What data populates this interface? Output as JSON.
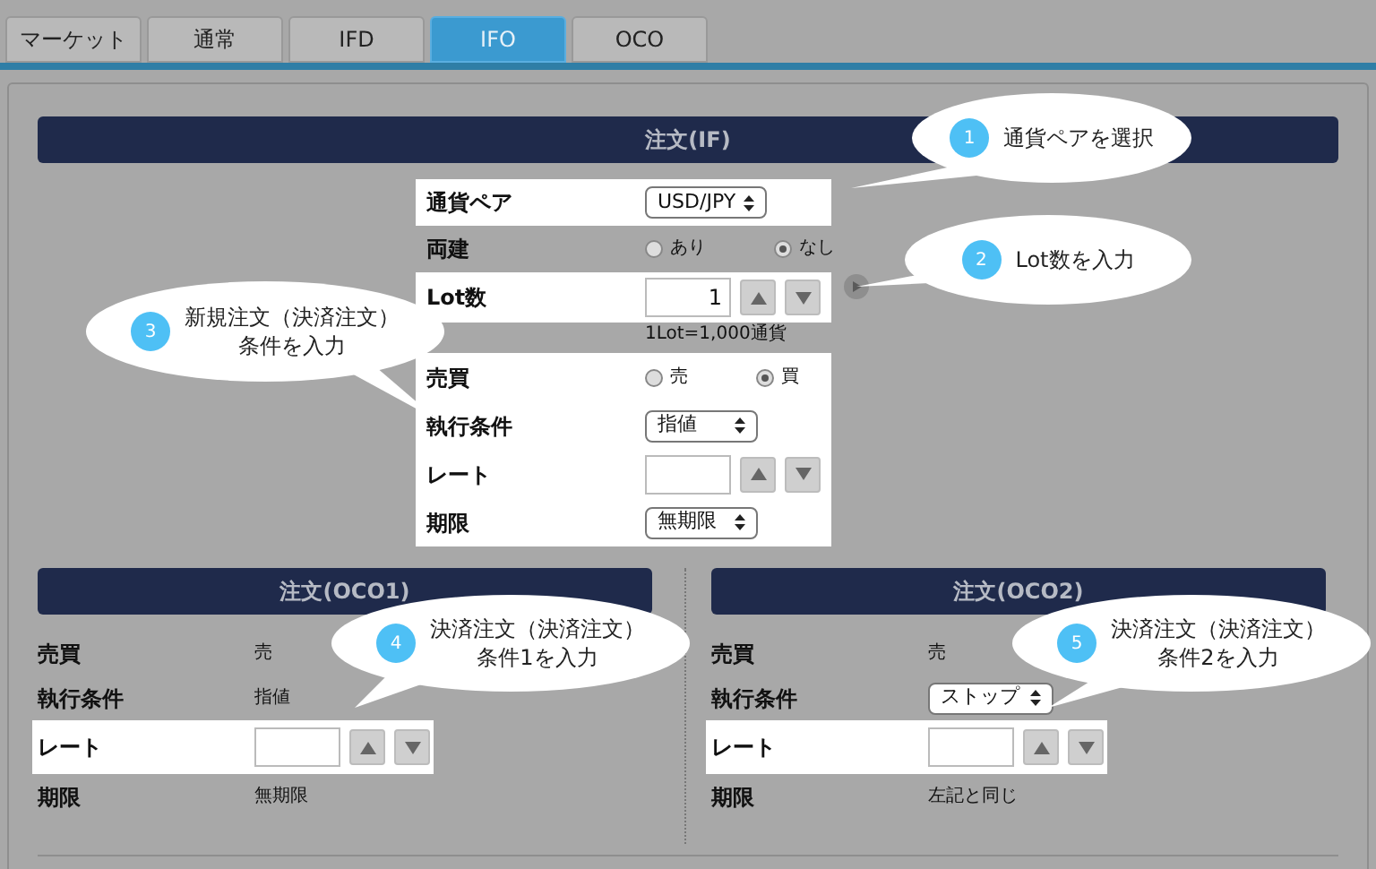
{
  "tabs": [
    {
      "label": "マーケット",
      "selected": false
    },
    {
      "label": "通常",
      "selected": false
    },
    {
      "label": "IFD",
      "selected": false
    },
    {
      "label": "IFO",
      "selected": true
    },
    {
      "label": "OCO",
      "selected": false
    }
  ],
  "if_order": {
    "title": "注文(IF)",
    "rows": [
      {
        "label": "通貨ペア",
        "kind": "select",
        "value": "USD/JPY",
        "highlighted": true
      },
      {
        "label": "両建",
        "kind": "radio",
        "options": [
          {
            "label": "あり",
            "selected": false
          },
          {
            "label": "なし",
            "selected": true
          }
        ],
        "highlighted": false
      },
      {
        "label": "Lot数",
        "kind": "stepper",
        "value": "1",
        "note": "1Lot=1,000通貨",
        "highlighted": true
      },
      {
        "label": "売買",
        "kind": "radio",
        "options": [
          {
            "label": "売",
            "selected": false
          },
          {
            "label": "買",
            "selected": true
          }
        ],
        "highlighted": true
      },
      {
        "label": "執行条件",
        "kind": "select",
        "value": "指値",
        "highlighted": true
      },
      {
        "label": "レート",
        "kind": "stepper",
        "highlighted": true
      },
      {
        "label": "期限",
        "kind": "select",
        "value": "無期限",
        "highlighted": true
      }
    ]
  },
  "oco_orders": [
    {
      "title": "注文(OCO1)",
      "rows": [
        {
          "label": "売買",
          "kind": "text",
          "value": "売",
          "highlighted": false
        },
        {
          "label": "執行条件",
          "kind": "text",
          "value": "指値",
          "highlighted": false
        },
        {
          "label": "レート",
          "kind": "stepper",
          "highlighted": true
        },
        {
          "label": "期限",
          "kind": "text",
          "value": "無期限",
          "highlighted": false
        }
      ]
    },
    {
      "title": "注文(OCO2)",
      "rows": [
        {
          "label": "売買",
          "kind": "text",
          "value": "売",
          "highlighted": false
        },
        {
          "label": "執行条件",
          "kind": "select",
          "value": "ストップ",
          "highlighted": false
        },
        {
          "label": "レート",
          "kind": "stepper",
          "highlighted": true
        },
        {
          "label": "期限",
          "kind": "text",
          "value": "左記と同じ",
          "highlighted": false
        }
      ]
    }
  ],
  "callouts": [
    {
      "number": "1",
      "lines": [
        "通貨ペアを選択"
      ]
    },
    {
      "number": "2",
      "lines": [
        "Lot数を入力"
      ]
    },
    {
      "number": "3",
      "lines": [
        "新規注文（決済注文）",
        "条件を入力"
      ]
    },
    {
      "number": "4",
      "lines": [
        "決済注文（決済注文）",
        "条件1を入力"
      ]
    },
    {
      "number": "5",
      "lines": [
        "決済注文（決済注文）",
        "条件2を入力"
      ]
    }
  ]
}
